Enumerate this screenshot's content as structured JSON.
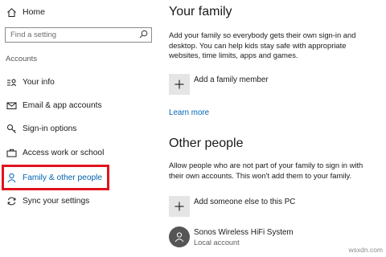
{
  "sidebar": {
    "home_label": "Home",
    "search_placeholder": "Find a setting",
    "section_label": "Accounts",
    "items": [
      {
        "label": "Your info",
        "icon": "person-card-icon"
      },
      {
        "label": "Email & app accounts",
        "icon": "mail-icon"
      },
      {
        "label": "Sign-in options",
        "icon": "key-icon"
      },
      {
        "label": "Access work or school",
        "icon": "briefcase-icon"
      },
      {
        "label": "Family & other people",
        "icon": "person-icon",
        "selected": true
      },
      {
        "label": "Sync your settings",
        "icon": "sync-icon"
      }
    ]
  },
  "main": {
    "family_heading": "Your family",
    "family_description": "Add your family so everybody gets their own sign-in and desktop. You can help kids stay safe with appropriate websites, time limits, apps and games.",
    "add_family_label": "Add a family member",
    "learn_more": "Learn more",
    "other_heading": "Other people",
    "other_description": "Allow people who are not part of your family to sign in with their own accounts. This won't add them to your family.",
    "add_other_label": "Add someone else to this PC",
    "account": {
      "name": "Sonos Wireless HiFi System",
      "type": "Local account"
    }
  },
  "watermark": "wsxdn.com",
  "colors": {
    "accent": "#0063b1",
    "highlight_box": "#e0141e",
    "tile": "#e5e5e5",
    "avatar": "#555555"
  }
}
